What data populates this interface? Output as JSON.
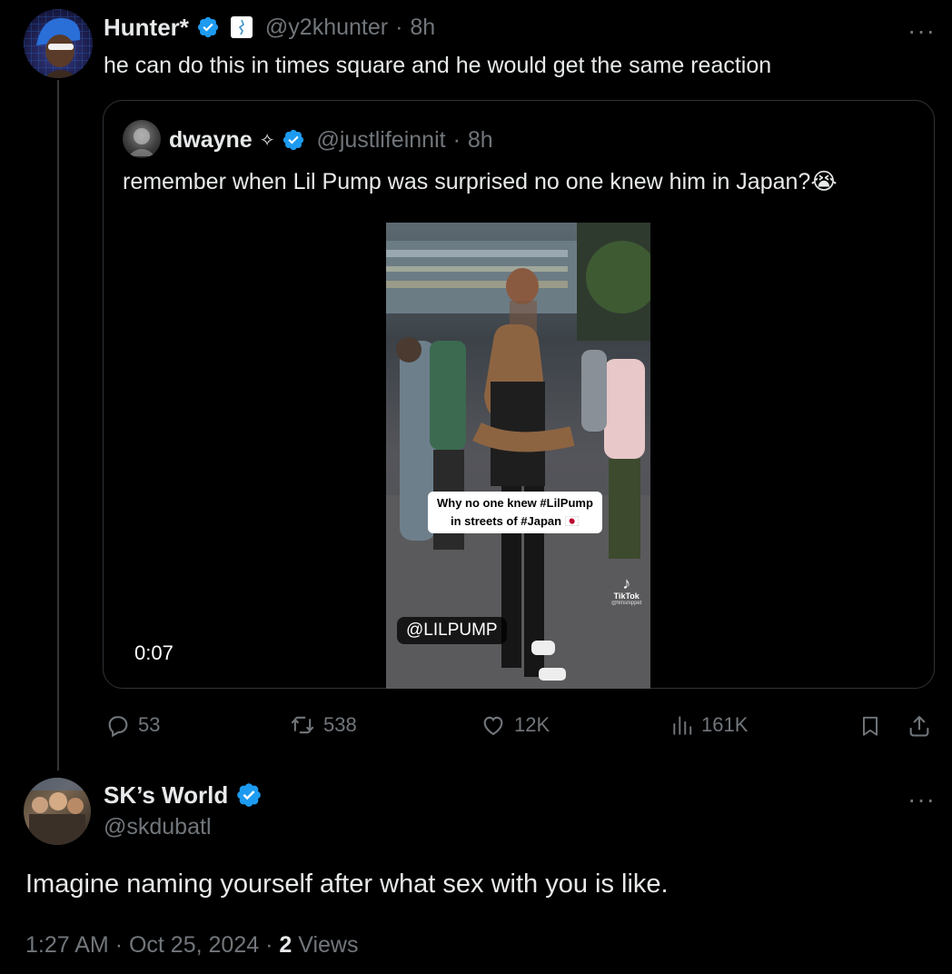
{
  "post": {
    "author_name": "Hunter*",
    "handle": "@y2khunter",
    "time": "8h",
    "separator": "·",
    "text": "he can do this in times square and he would get the same reaction",
    "more_glyph": "···"
  },
  "quote": {
    "author_name": "dwayne",
    "author_suffix": "✧",
    "handle": "@justlifeinnit",
    "time": "8h",
    "separator": "·",
    "text": "remember when Lil Pump was surprised no one knew him in Japan?😭",
    "video": {
      "duration": "0:07",
      "caption_line1": "Why no one knew #LilPump",
      "caption_line2": "in streets of #Japan 🇯🇵",
      "tag": "@LILPUMP",
      "watermark": "TikTok",
      "watermark_handle": "@fimsnippet"
    }
  },
  "actions": {
    "replies": "53",
    "reposts": "538",
    "likes": "12K",
    "views": "161K"
  },
  "reply": {
    "author_name": "SK’s World",
    "handle": "@skdubatl",
    "text": "Imagine naming yourself after what sex with you is like.",
    "time": "1:27 AM",
    "date": "Oct 25, 2024",
    "separator": "·",
    "views_count": "2",
    "views_label": "Views",
    "more_glyph": "···"
  },
  "colors": {
    "background": "#000000",
    "text": "#e7e9ea",
    "muted": "#71767b",
    "verified": "#1d9bf0",
    "border": "#2f3336"
  },
  "icons": [
    "verified-badge-icon",
    "affiliate-badge-icon",
    "reply-icon",
    "repost-icon",
    "like-icon",
    "views-icon",
    "bookmark-icon",
    "share-icon",
    "more-icon"
  ]
}
